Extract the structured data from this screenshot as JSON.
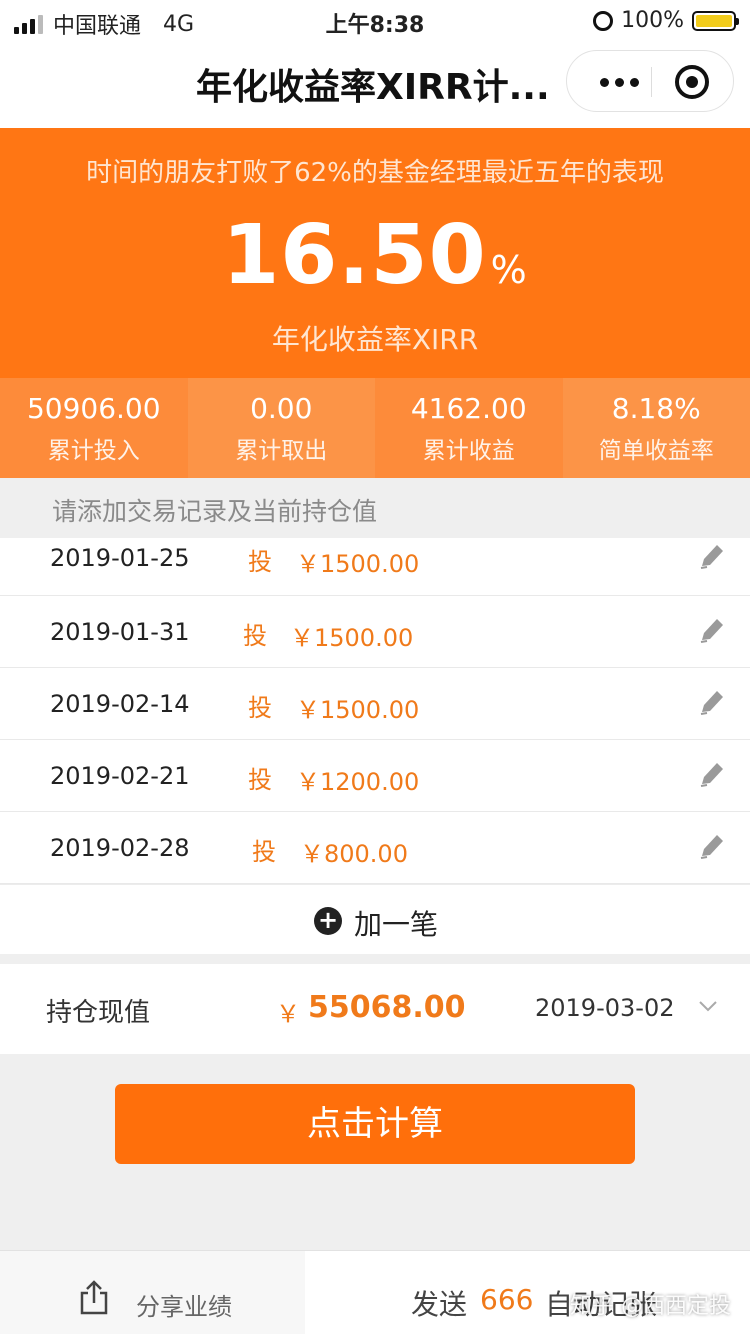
{
  "status_bar": {
    "carrier": "中国联通",
    "network": "4G",
    "time": "上午8:38",
    "battery": "100%"
  },
  "nav": {
    "title": "年化收益率XIRR计..."
  },
  "hero": {
    "tagline": "时间的朋友打败了62%的基金经理最近五年的表现",
    "rate_value": "16.50",
    "rate_unit": "%",
    "rate_label": "年化收益率XIRR"
  },
  "stats": [
    {
      "value": "50906.00",
      "label": "累计投入"
    },
    {
      "value": "0.00",
      "label": "累计取出"
    },
    {
      "value": "4162.00",
      "label": "累计收益"
    },
    {
      "value": "8.18%",
      "label": "简单收益率"
    }
  ],
  "hint": "请添加交易记录及当前持仓值",
  "records": [
    {
      "date": "2019-01-25",
      "type": "投",
      "amount": "￥1500.00"
    },
    {
      "date": "2019-01-31",
      "type": "投",
      "amount": "￥1500.00"
    },
    {
      "date": "2019-02-14",
      "type": "投",
      "amount": "￥1500.00"
    },
    {
      "date": "2019-02-21",
      "type": "投",
      "amount": "￥1200.00"
    },
    {
      "date": "2019-02-28",
      "type": "投",
      "amount": "￥800.00"
    }
  ],
  "add_label": "加一笔",
  "holding": {
    "label": "持仓现值",
    "currency": "￥",
    "value": "55068.00",
    "date": "2019-03-02"
  },
  "calc_button": "点击计算",
  "bottom": {
    "share_label": "分享业绩",
    "send_prefix": "发送",
    "send_code": "666",
    "send_suffix": "自动记张"
  },
  "watermark": "知乎 @西西定投",
  "colors": {
    "accent": "#ff7614",
    "amount": "#f07a1a"
  },
  "icons": {
    "edit": "pencil-icon",
    "add": "plus-circle-icon",
    "share": "share-icon",
    "dropdown": "chevron-down-icon"
  }
}
